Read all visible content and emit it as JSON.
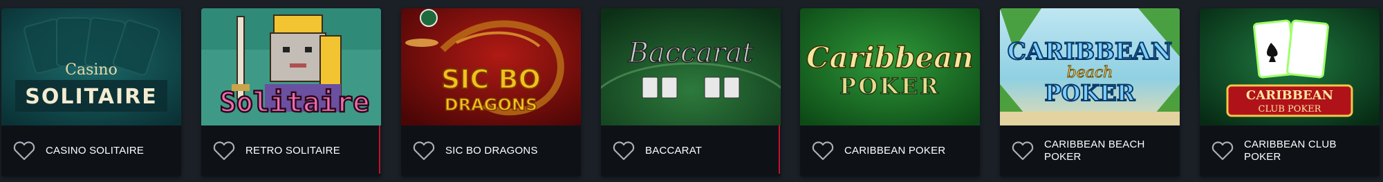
{
  "games": [
    {
      "title": "CASINO SOLITAIRE",
      "logo_line1": "Casino",
      "logo_line2": "SOLITAIRE"
    },
    {
      "title": "RETRO SOLITAIRE",
      "logo": "Solitaire"
    },
    {
      "title": "SIC BO DRAGONS",
      "logo_line1": "SIC BO",
      "logo_line2": "DRAGONS"
    },
    {
      "title": "BACCARAT",
      "logo": "Baccarat"
    },
    {
      "title": "CARIBBEAN POKER",
      "logo_line1": "Caribbean",
      "logo_line2": "POKER"
    },
    {
      "title": "CARIBBEAN BEACH POKER",
      "logo_line1": "CARIBBEAN",
      "logo_line2": "beach",
      "logo_line3": "POKER"
    },
    {
      "title": "CARIBBEAN CLUB POKER",
      "logo_line1": "CARIBBEAN",
      "logo_line2": "CLUB POKER"
    }
  ],
  "icons": {
    "favorite": "heart-outline-icon"
  },
  "colors": {
    "page_bg": "#1b2027",
    "card_footer": "#0e1217",
    "accent_red": "#c8102e"
  }
}
